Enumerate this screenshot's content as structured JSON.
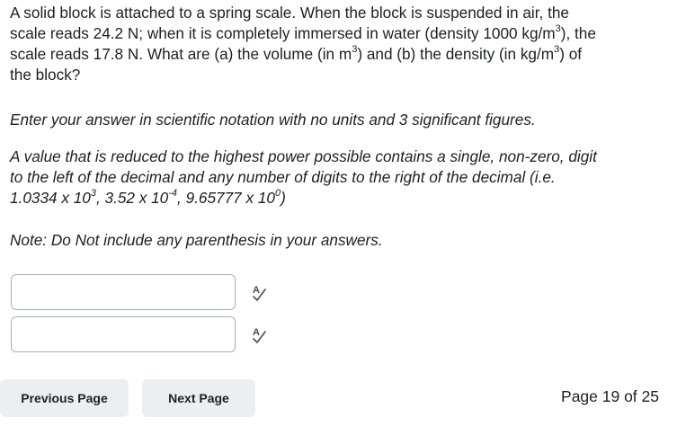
{
  "question": {
    "l1": "A solid block is attached to a spring scale. When the block is suspended in air, the",
    "l2a": "scale reads 24.2 N; when it is completely immersed in water (density 1000 kg/m",
    "l2sup": "3",
    "l2b": "), the",
    "l3a": "scale reads 17.8 N. What are (a) the volume (in m",
    "l3sup1": "3",
    "l3b": ") and (b) the density (in kg/m",
    "l3sup2": "3",
    "l3c": ") of",
    "l4": "the block?"
  },
  "instructions": {
    "sci_notation": "Enter your answer in scientific notation with no units and 3 significant figures.",
    "explain_l1": "A value that is reduced to the highest power possible contains a single, non-zero, digit",
    "explain_l2": "to the left of the decimal and any number of digits to the right of the decimal (i.e.",
    "ex1_base": "1.0334 x 10",
    "ex1_exp": "3",
    "ex2_base": ", 3.52 x 10",
    "ex2_exp": "-4",
    "ex3_base": ", 9.65777 x 10",
    "ex3_exp": "0",
    "ex_close": ")",
    "note": "Note: Do Not include any parenthesis in your answers."
  },
  "answers": [
    {
      "value": "",
      "placeholder": "",
      "spellcheck_icon": "spellcheck-icon"
    },
    {
      "value": "",
      "placeholder": "",
      "spellcheck_icon": "spellcheck-icon"
    }
  ],
  "navigation": {
    "previous_label": "Previous Page",
    "next_label": "Next Page",
    "page_indicator": "Page 19 of 25"
  },
  "colors": {
    "text": "#202122",
    "button_bg": "#eceef0",
    "input_border": "#a9aeb4"
  }
}
